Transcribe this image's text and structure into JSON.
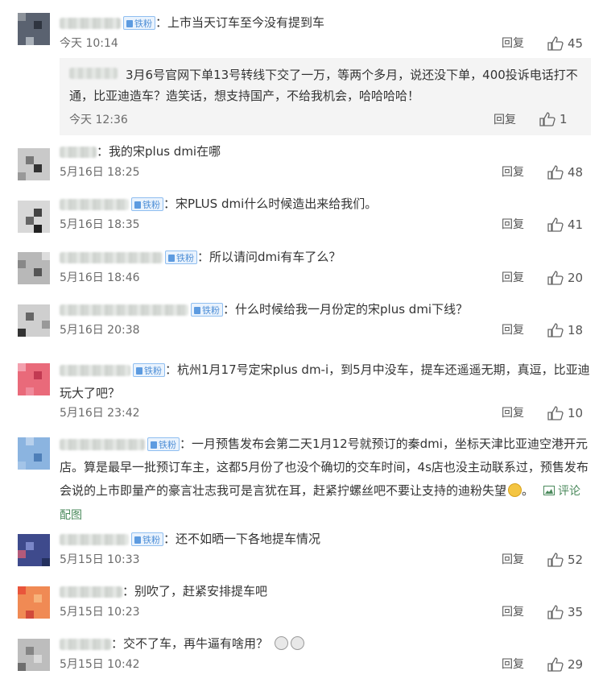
{
  "badge_label": "铁粉",
  "reply_label": "回复",
  "comments": [
    {
      "text": "上市当天订车至今没有提到车",
      "time": "今天 10:14",
      "likes": "45"
    },
    {
      "text": "3月6号官网下单13号转线下交了一万，等两个多月，说还没下单，400投诉电话打不通，比亚迪造车？造笑话，想支持国产，不给我机会，哈哈哈哈！",
      "time": "今天 12:36",
      "likes": "1"
    },
    {
      "text": "我的宋plus dmi在哪",
      "time": "5月16日 18:25",
      "likes": "48"
    },
    {
      "text": "宋PLUS dmi什么时候造出来给我们。",
      "time": "5月16日 18:35",
      "likes": "41"
    },
    {
      "text": "所以请问dmi有车了么？",
      "time": "5月16日 18:46",
      "likes": "20"
    },
    {
      "text": "什么时候给我一月份定的宋plus dmi下线？",
      "time": "5月16日 20:38",
      "likes": "18"
    },
    {
      "text": "杭州1月17号定宋plus dm-i，到5月中没车，提车还遥遥无期，真逗，比亚迪玩大了吧？",
      "time": "5月16日 23:42",
      "likes": "10"
    },
    {
      "text": "一月预售发布会第二天1月12号就预订的秦dmi，坐标天津比亚迪空港开元店。算是最早一批预订车主，这都5月份了也没个确切的交车时间，4s店也没主动联系过，预售发布会说的上市即量产的豪言壮志我可是言犹在耳，赶紧拧螺丝吧不要让支持的迪粉失望",
      "suffix": "。",
      "pic_label": "评论配图"
    },
    {
      "text": "还不如晒一下各地提车情况",
      "time": "5月15日 10:33",
      "likes": "52"
    },
    {
      "text": "别吹了，赶紧安排提车吧",
      "time": "5月15日 10:23",
      "likes": "35"
    },
    {
      "text": "交不了车，再牛逼有啥用？",
      "time": "5月15日 10:42",
      "likes": "29"
    }
  ],
  "colors": {
    "badge_text": "#4f8fd6",
    "meta_text": "#6b6b6b",
    "pic_link": "#4b8a5c",
    "sub_bg": "#f4f4f4"
  },
  "icons": {
    "like": "thumbs-up-icon",
    "badge": "fan-badge-icon",
    "pic": "image-icon",
    "emoji": "sad-face-icon"
  }
}
